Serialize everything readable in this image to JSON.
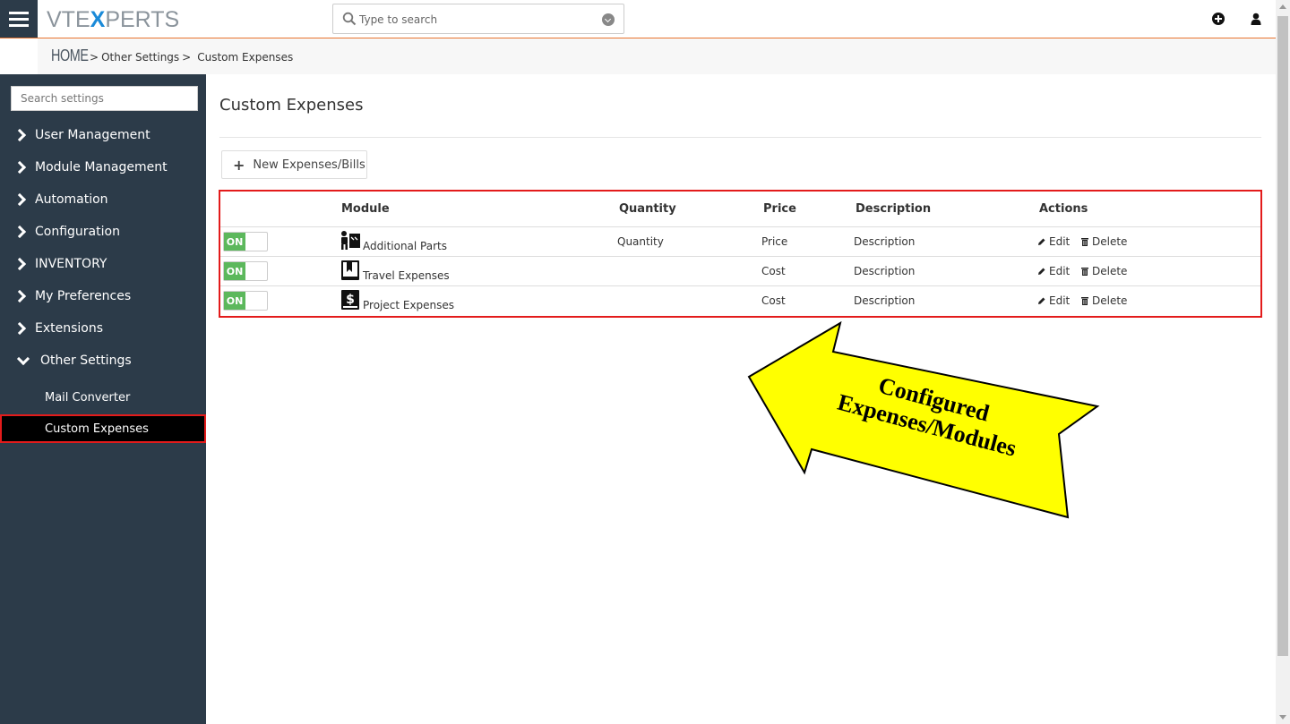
{
  "header": {
    "logo_left": "VTE",
    "logo_x": "X",
    "logo_right": "PERTS",
    "search_placeholder": "Type to search"
  },
  "breadcrumb": {
    "home": "HOME",
    "sep": ">",
    "level1": "Other Settings",
    "level2": "Custom Expenses"
  },
  "sidebar": {
    "search_placeholder": "Search settings",
    "items": [
      {
        "label": "User Management"
      },
      {
        "label": "Module Management"
      },
      {
        "label": "Automation"
      },
      {
        "label": "Configuration"
      },
      {
        "label": "INVENTORY"
      },
      {
        "label": "My Preferences"
      },
      {
        "label": "Extensions"
      },
      {
        "label": "Other Settings"
      }
    ],
    "sub_items": [
      {
        "label": "Mail Converter"
      },
      {
        "label": "Custom Expenses"
      }
    ]
  },
  "main": {
    "title": "Custom Expenses",
    "new_button": "New Expenses/Bills",
    "columns": {
      "module": "Module",
      "quantity": "Quantity",
      "price": "Price",
      "description": "Description",
      "actions": "Actions"
    },
    "rows": [
      {
        "toggle": "ON",
        "icon": "parts-icon",
        "module": "Additional Parts",
        "quantity": "Quantity",
        "price": "Price",
        "description": "Description",
        "edit": "Edit",
        "delete": "Delete"
      },
      {
        "toggle": "ON",
        "icon": "travel-icon",
        "module": "Travel Expenses",
        "quantity": "",
        "price": "Cost",
        "description": "Description",
        "edit": "Edit",
        "delete": "Delete"
      },
      {
        "toggle": "ON",
        "icon": "project-expense-icon",
        "module": "Project Expenses",
        "quantity": "",
        "price": "Cost",
        "description": "Description",
        "edit": "Edit",
        "delete": "Delete"
      }
    ]
  },
  "callout": {
    "line1": "Configured",
    "line2": "Expenses/Modules",
    "color": "#ffff00"
  },
  "colors": {
    "sidebar_bg": "#2c3b49",
    "accent_orange": "#e8742e",
    "highlight_red": "#e31b1b",
    "toggle_green": "#5cb85c"
  }
}
